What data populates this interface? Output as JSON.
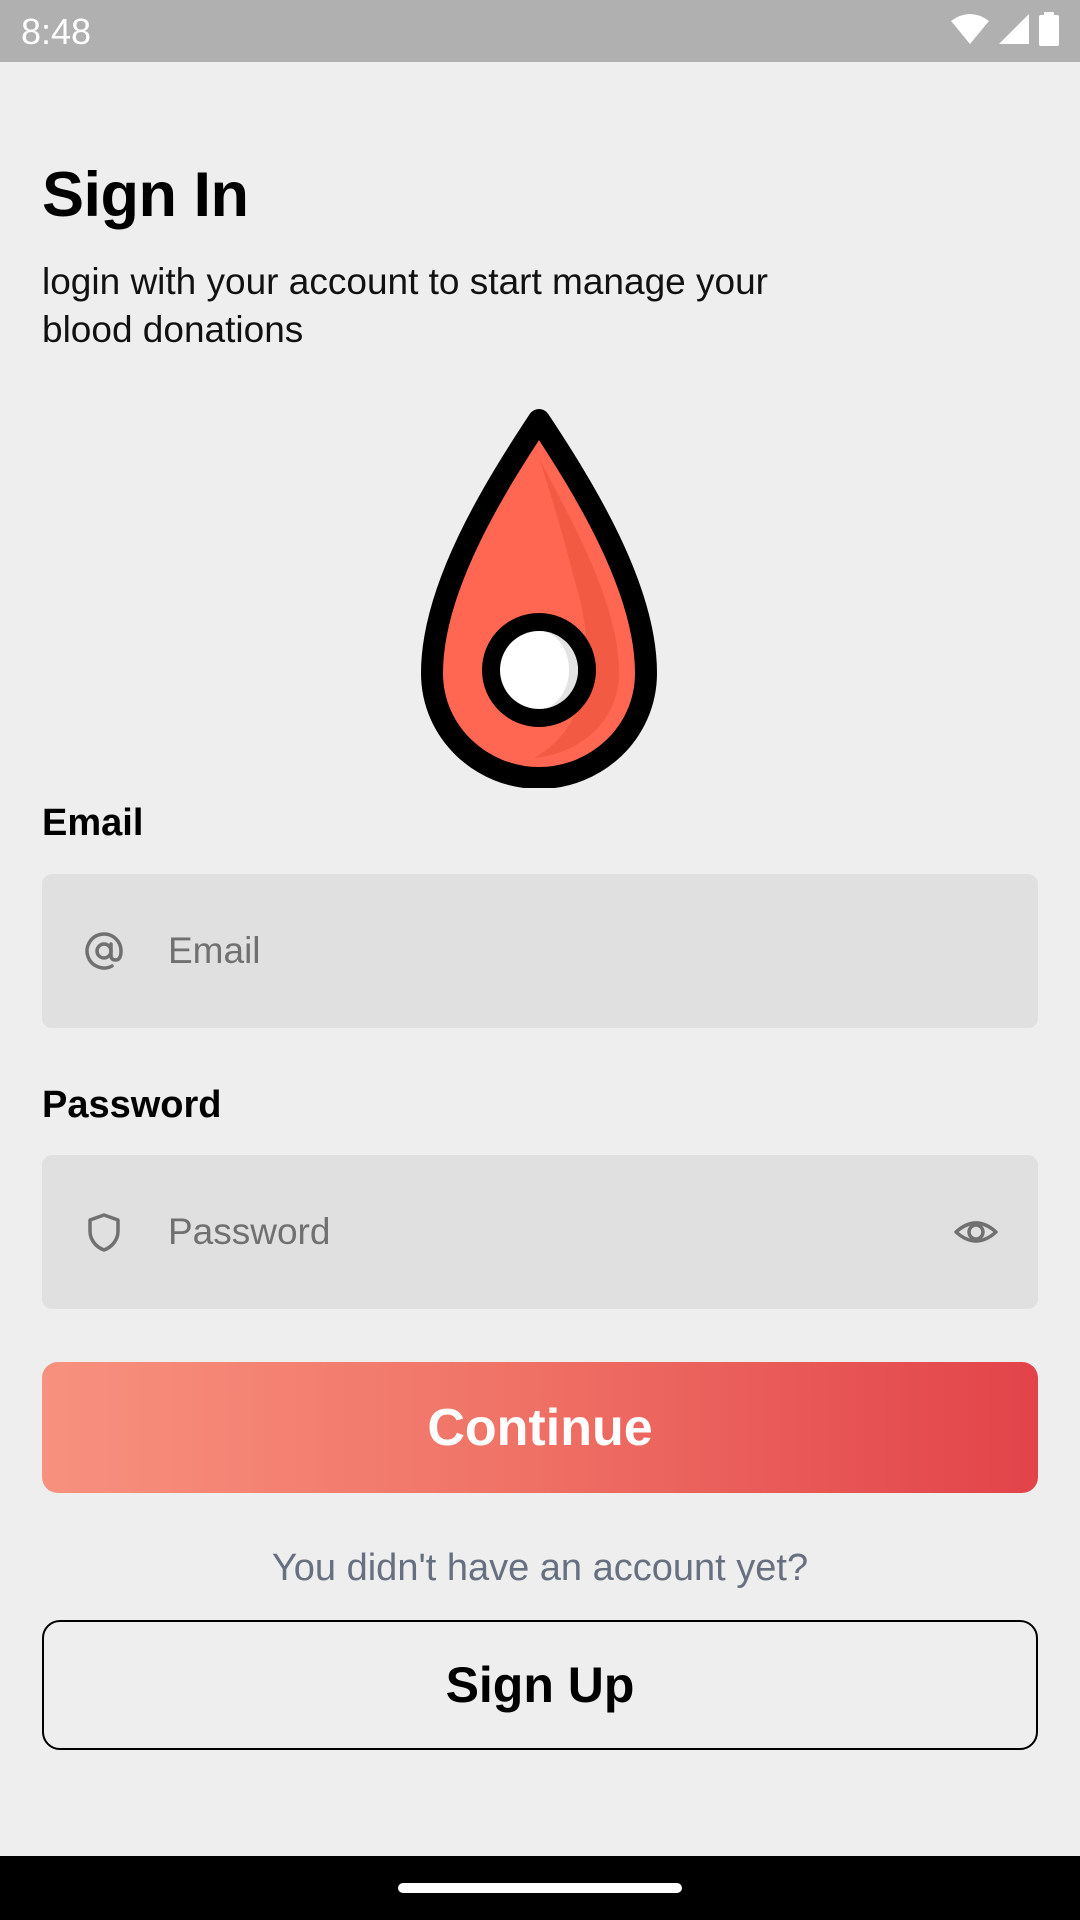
{
  "status_bar": {
    "time": "8:48",
    "icons": [
      "wifi-icon",
      "signal-icon",
      "battery-icon"
    ]
  },
  "header": {
    "title": "Sign In",
    "subtitle": "login with your account to start manage your blood donations"
  },
  "logo": {
    "icon": "blood-drop-logo",
    "colors": {
      "fill": "#ff6752",
      "shade": "#f35a44",
      "outline": "#000000"
    }
  },
  "form": {
    "email": {
      "label": "Email",
      "placeholder": "Email",
      "value": "",
      "icon": "at-sign-icon"
    },
    "password": {
      "label": "Password",
      "placeholder": "Password",
      "value": "",
      "icon": "shield-icon",
      "toggle_icon": "eye-icon"
    },
    "continue_label": "Continue",
    "continue_gradient": [
      "#f8917f",
      "#e2434a"
    ]
  },
  "signup": {
    "hint": "You didn't have an account yet?",
    "button_label": "Sign Up"
  },
  "colors": {
    "background": "#eeeeee",
    "input_background": "#e0e0e0",
    "hint_text": "#667080"
  }
}
